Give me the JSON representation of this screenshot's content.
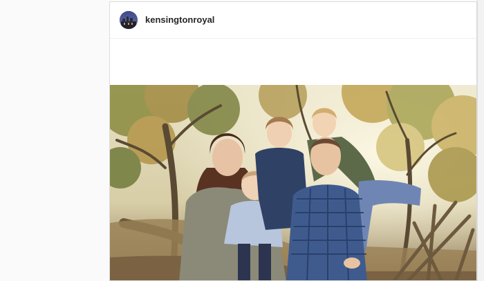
{
  "post": {
    "username": "kensingtonroyal"
  },
  "icons": {
    "avatar": "profile-avatar-icon"
  }
}
